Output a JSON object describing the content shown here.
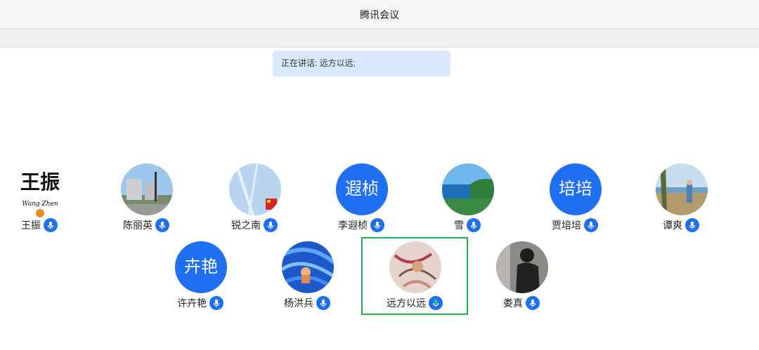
{
  "window": {
    "title": "腾讯会议"
  },
  "banner": {
    "label": "正在讲话: 远方以远;"
  },
  "participants": [
    {
      "name": "王振",
      "avatar_type": "calligraphy",
      "avatar_text": "王振",
      "avatar_sub": "Wang Zhen",
      "is_host": true
    },
    {
      "name": "陈丽英",
      "avatar_type": "photo"
    },
    {
      "name": "锐之南",
      "avatar_type": "photo"
    },
    {
      "name": "李遐桢",
      "avatar_type": "text",
      "avatar_text": "遐桢"
    },
    {
      "name": "雪",
      "avatar_type": "photo"
    },
    {
      "name": "贾培培",
      "avatar_type": "text",
      "avatar_text": "培培"
    },
    {
      "name": "谭爽",
      "avatar_type": "photo"
    },
    {
      "name": "许卉艳",
      "avatar_type": "text",
      "avatar_text": "卉艳"
    },
    {
      "name": "杨洪兵",
      "avatar_type": "photo"
    },
    {
      "name": "远方以远",
      "avatar_type": "photo",
      "speaking": true
    },
    {
      "name": "娄真",
      "avatar_type": "photo"
    }
  ],
  "colors": {
    "accent": "#1e6ff2",
    "speaking_frame": "#22b24c",
    "speaking_mic": "#2ecc71",
    "banner_bg": "#dbe9fc"
  },
  "icons": {
    "mic": "microphone-icon",
    "host": "host-badge-icon"
  }
}
